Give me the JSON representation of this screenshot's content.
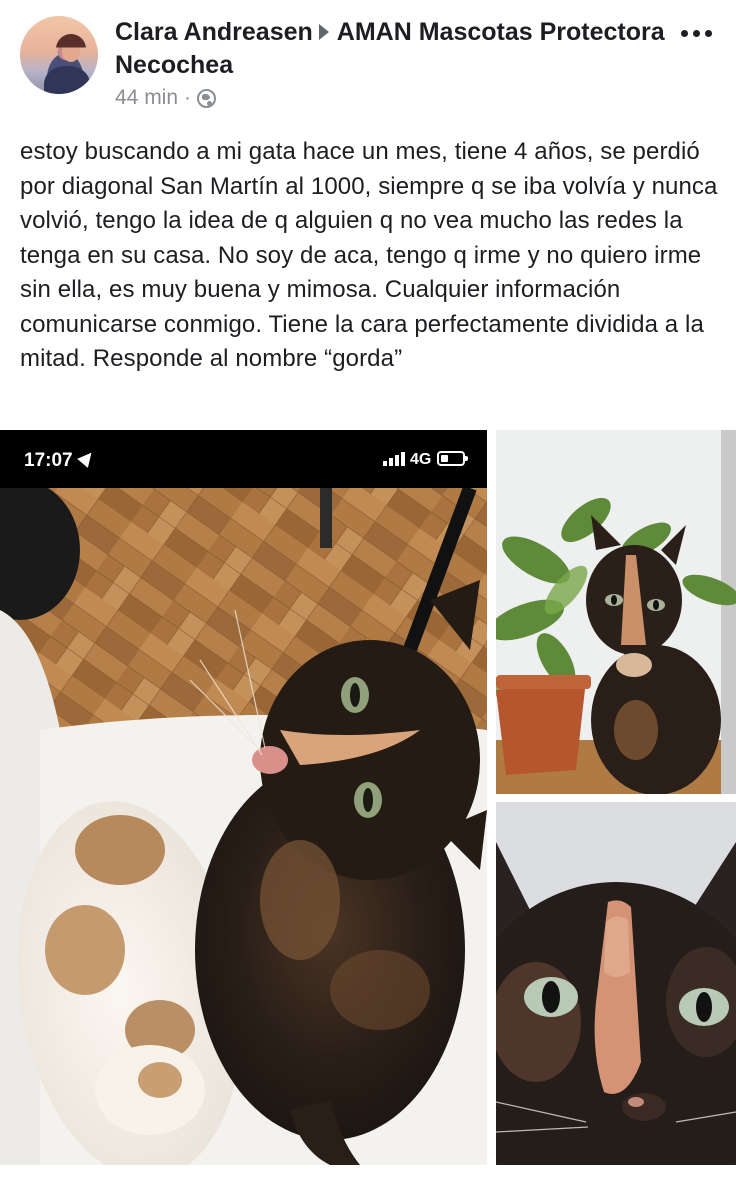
{
  "post": {
    "author": "Clara Andreasen",
    "group": "AMAN Mascotas Protectora Necochea",
    "timestamp": "44 min",
    "separator": "·",
    "text": "estoy buscando a mi gata hace un mes, tiene 4 años, se perdió por diagonal San Martín al 1000, siempre q se iba volvía y nunca volvió, tengo la idea de q alguien q no vea mucho las redes la tenga en su casa. No soy de aca, tengo q irme y no quiero irme sin ella, es muy buena y mimosa. Cualquier información comunicarse conmigo. Tiene la cara perfectamente dividida a la mitad. Responde al nombre “gorda”"
  },
  "photo_main": {
    "status_time": "17:07",
    "status_network": "4G",
    "icons": [
      "location-arrow-icon",
      "signal-bars-icon",
      "battery-icon"
    ]
  },
  "icons": {
    "privacy": "globe-icon",
    "menu": "more-options-icon",
    "share_arrow": "caret-right-icon"
  },
  "colors": {
    "text": "#1c1e21",
    "meta": "#8a8d91",
    "statusbar": "#000000"
  }
}
